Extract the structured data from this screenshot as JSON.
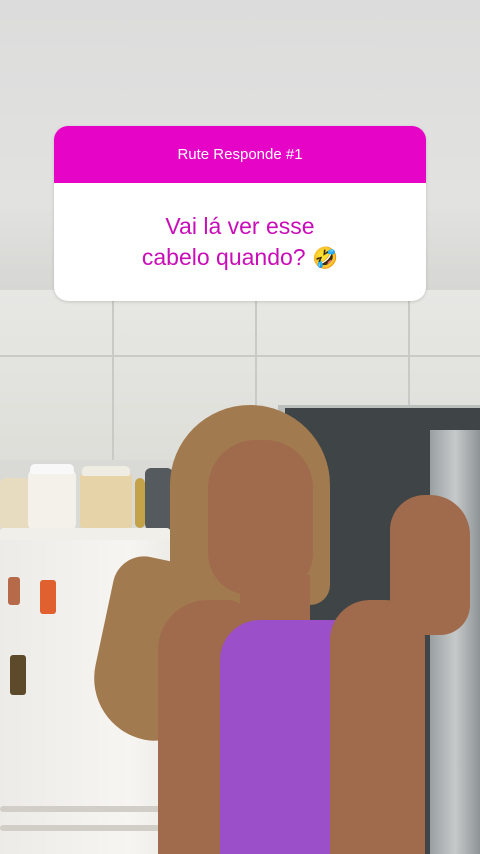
{
  "question_card": {
    "header": "Rute Responde #1",
    "question_line1": "Vai lá ver esse",
    "question_line2": "cabelo quando?",
    "emoji": "🤣",
    "header_color": "#e604c6",
    "question_color": "#c90db8"
  },
  "scene": {
    "description_icons": [
      "fridge-icon",
      "jar-icon",
      "door-icon"
    ]
  }
}
